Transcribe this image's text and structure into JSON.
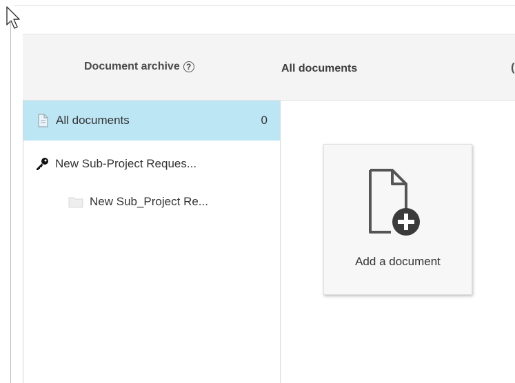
{
  "header": {
    "title": "Document archive",
    "help_glyph": "?",
    "current_view": "All documents",
    "cut_off_text": "("
  },
  "sidebar": {
    "items": [
      {
        "label": "All documents",
        "count": "0",
        "icon": "document-icon",
        "selected": true
      },
      {
        "label": "New Sub-Project Reques...",
        "icon": "key-icon"
      },
      {
        "label": "New Sub_Project Re...",
        "icon": "folder-icon"
      }
    ]
  },
  "main": {
    "add_card_label": "Add a document",
    "add_card_icon": "add-document-icon"
  },
  "colors": {
    "selected_row": "#bde6f5",
    "header_bg": "#f4f4f4"
  }
}
